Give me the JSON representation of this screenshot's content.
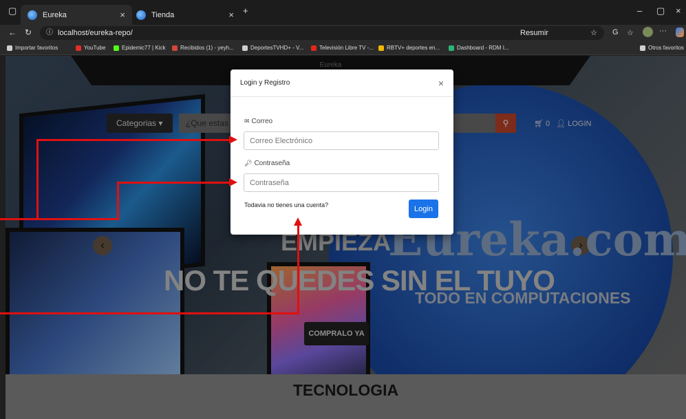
{
  "browser": {
    "tabs": [
      {
        "label": "Eureka"
      },
      {
        "label": "Tienda"
      }
    ],
    "url": "localhost/eureka-repo/",
    "resumir_label": "Resumir",
    "bookmarks": [
      {
        "label": "Importar favoritos",
        "color": "#cfcfcf"
      },
      {
        "label": "YouTube",
        "color": "#e52d27"
      },
      {
        "label": "Epidemic77 | Kick",
        "color": "#53fc18"
      },
      {
        "label": "Recibidos (1) - yeyh...",
        "color": "#d44638"
      },
      {
        "label": "DeportesTVHD+ - V...",
        "color": "#cfcfcf"
      },
      {
        "label": "Televisión Libre TV -...",
        "color": "#e0281a"
      },
      {
        "label": "RBTV+ deportes en...",
        "color": "#f2b705"
      },
      {
        "label": "Dashboard - RDM I...",
        "color": "#2bb673"
      }
    ],
    "other_favorites": "Otros favoritos"
  },
  "site": {
    "header_text": "Eureka",
    "categories_label": "Categorias ▾",
    "search_placeholder": "¿Que estas b",
    "cart_count": "0",
    "login_link": "LOGIN",
    "headline_1": "EMPIEZA",
    "headline_2": "NO TE QUEDES SIN EL TUYO",
    "brand": "Eureka.com",
    "tagline": "TODO EN COMPUTACIONES",
    "cta": "COMPRALO YA",
    "section_title": "TECNOLOGIA"
  },
  "modal": {
    "title": "Login y Registro",
    "close": "×",
    "email_label": "Correo",
    "email_placeholder": "Correo Electrónico",
    "password_label": "Contraseña",
    "password_placeholder": "Contraseña",
    "no_account": "Todavia no tienes una cuenta?",
    "login_button": "Login"
  },
  "colors": {
    "annotation": "#e01010",
    "primary_button": "#1a73e8",
    "search_button": "#c0432a"
  }
}
